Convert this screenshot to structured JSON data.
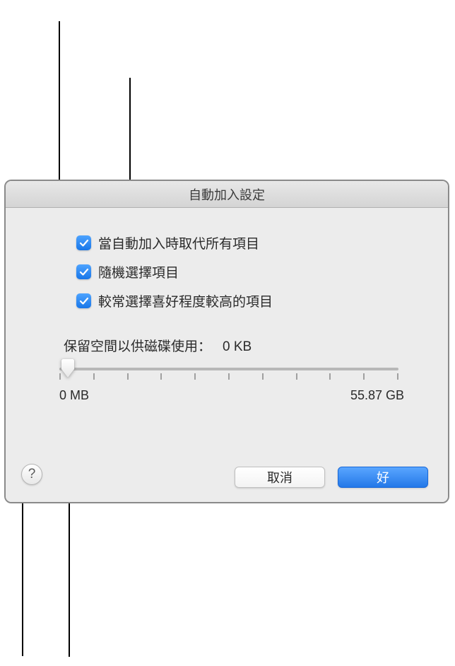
{
  "dialog": {
    "title": "自動加入設定",
    "checkboxes": [
      {
        "label": "當自動加入時取代所有項目",
        "checked": true
      },
      {
        "label": "隨機選擇項目",
        "checked": true
      },
      {
        "label": "較常選擇喜好程度較高的項目",
        "checked": true
      }
    ],
    "reserve": {
      "label": "保留空間以供磁碟使用：",
      "value": "0 KB",
      "min_label": "0 MB",
      "max_label": "55.87 GB"
    },
    "buttons": {
      "help": "?",
      "cancel": "取消",
      "ok": "好"
    }
  }
}
